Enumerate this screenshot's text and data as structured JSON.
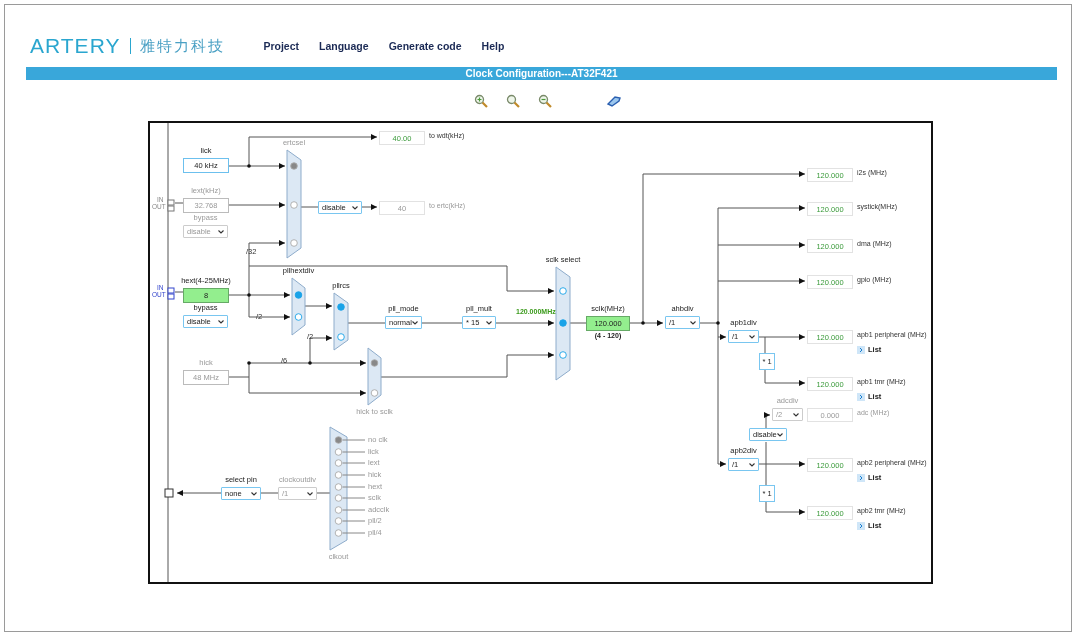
{
  "header": {
    "logo": "ARTERY",
    "company": "雅特力科技",
    "menu": [
      "Project",
      "Language",
      "Generate code",
      "Help"
    ]
  },
  "title_bar": {
    "title": "Clock Configuration---AT32F421"
  },
  "diagram": {
    "pins": [
      {
        "in": "IN",
        "out": "OUT",
        "enabled": false
      },
      {
        "in": "IN",
        "out": "OUT",
        "enabled": true
      }
    ],
    "fields": [
      {
        "kind": "input",
        "label": "lick",
        "value": "40 kHz",
        "enabled": true,
        "valid": false
      },
      {
        "kind": "input",
        "label": "lext(kHz)",
        "value": "32.768",
        "enabled": false,
        "valid": false
      },
      {
        "kind": "select",
        "label": "bypass",
        "value": "disable",
        "enabled": false,
        "valid": false
      },
      {
        "kind": "input",
        "label": "hext(4-25MHz)",
        "value": "8",
        "enabled": true,
        "valid": true
      },
      {
        "kind": "select",
        "label": "bypass",
        "value": "disable",
        "enabled": true,
        "valid": false
      },
      {
        "kind": "input",
        "label": "hick",
        "value": "48 MHz",
        "enabled": false,
        "valid": false
      },
      {
        "kind": "readout",
        "label": "to wdt(kHz)",
        "value": "40.00",
        "enabled": true,
        "valid": false
      },
      {
        "kind": "select",
        "value": "disable",
        "enabled": true,
        "valid": false
      },
      {
        "kind": "readout",
        "label": "to ertc(kHz)",
        "value": "40",
        "enabled": false,
        "valid": false
      },
      {
        "kind": "select",
        "label": "pll_mode",
        "value": "normal",
        "enabled": true,
        "valid": false
      },
      {
        "kind": "select",
        "label": "pll_mult",
        "value": "* 15",
        "enabled": true,
        "valid": false
      },
      {
        "kind": "input",
        "label": "sclk(MHz)",
        "value": "120.000",
        "range": "(4 - 120)",
        "enabled": true,
        "valid": true
      },
      {
        "kind": "select",
        "label": "ahbdiv",
        "value": "/1",
        "enabled": true,
        "valid": false
      },
      {
        "kind": "readout",
        "label": "i2s (MHz)",
        "value": "120.000",
        "enabled": true,
        "valid": false
      },
      {
        "kind": "readout",
        "label": "systick(MHz)",
        "value": "120.000",
        "enabled": true,
        "valid": false
      },
      {
        "kind": "readout",
        "label": "dma (MHz)",
        "value": "120.000",
        "enabled": true,
        "valid": false
      },
      {
        "kind": "readout",
        "label": "gpio (MHz)",
        "value": "120.000",
        "enabled": true,
        "valid": false
      },
      {
        "kind": "select",
        "label": "apb1div",
        "value": "/1",
        "enabled": true,
        "valid": false
      },
      {
        "kind": "readout",
        "label": "apb1 peripheral (MHz)",
        "value": "120.000",
        "link": "List",
        "enabled": true,
        "valid": false
      },
      {
        "kind": "readout",
        "label": "apb1 tmr (MHz)",
        "value": "120.000",
        "link": "List",
        "enabled": true,
        "valid": false
      },
      {
        "kind": "select",
        "label": "adcdiv",
        "value": "/2",
        "enabled": false,
        "valid": false
      },
      {
        "kind": "readout",
        "label": "adc (MHz)",
        "value": "0.000",
        "enabled": false,
        "valid": false
      },
      {
        "kind": "select",
        "value": "disable",
        "enabled": true,
        "valid": false
      },
      {
        "kind": "select",
        "label": "apb2div",
        "value": "/1",
        "enabled": true,
        "valid": false
      },
      {
        "kind": "readout",
        "label": "apb2 peripheral (MHz)",
        "value": "120.000",
        "link": "List",
        "enabled": true,
        "valid": false
      },
      {
        "kind": "readout",
        "label": "apb2 tmr (MHz)",
        "value": "120.000",
        "link": "List",
        "enabled": true,
        "valid": false
      },
      {
        "kind": "select",
        "label": "select pin",
        "value": "none",
        "enabled": true,
        "valid": false
      },
      {
        "kind": "select",
        "label": "clockoutdiv",
        "value": "/1",
        "enabled": false,
        "valid": false
      }
    ],
    "muxes": [
      {
        "label": "ertcsel",
        "enabled": false,
        "inputs": [
          {
            "selected": true
          },
          {
            "selected": false
          },
          {
            "selected": false
          }
        ]
      },
      {
        "label": "pllhextdiv",
        "enabled": true,
        "inputs": [
          {
            "selected": true
          },
          {
            "selected": false
          }
        ]
      },
      {
        "label": "pllrcs",
        "enabled": true,
        "inputs": [
          {
            "selected": true
          },
          {
            "selected": false
          }
        ]
      },
      {
        "label": "sclk select",
        "enabled": true,
        "inputs": [
          {
            "selected": false
          },
          {
            "selected": true
          },
          {
            "selected": false
          }
        ]
      },
      {
        "label": "hick to sclk",
        "enabled": false,
        "inputs": [
          {
            "selected": true
          },
          {
            "selected": false
          }
        ]
      },
      {
        "label": "clkout",
        "enabled": false,
        "inputs": [
          {
            "label": "no clk",
            "selected": true
          },
          {
            "label": "lick",
            "selected": false
          },
          {
            "label": "lext",
            "selected": false
          },
          {
            "label": "hick",
            "selected": false
          },
          {
            "label": "hext",
            "selected": false
          },
          {
            "label": "sclk",
            "selected": false
          },
          {
            "label": "adcclk",
            "selected": false
          },
          {
            "label": "pll/2",
            "selected": false
          },
          {
            "label": "pll/4",
            "selected": false
          }
        ]
      }
    ],
    "dividers": [
      "/32",
      "/2",
      "/2",
      "/6"
    ],
    "multipliers": [
      "* 1",
      "* 1"
    ],
    "pll_output": "120.000MHz"
  }
}
